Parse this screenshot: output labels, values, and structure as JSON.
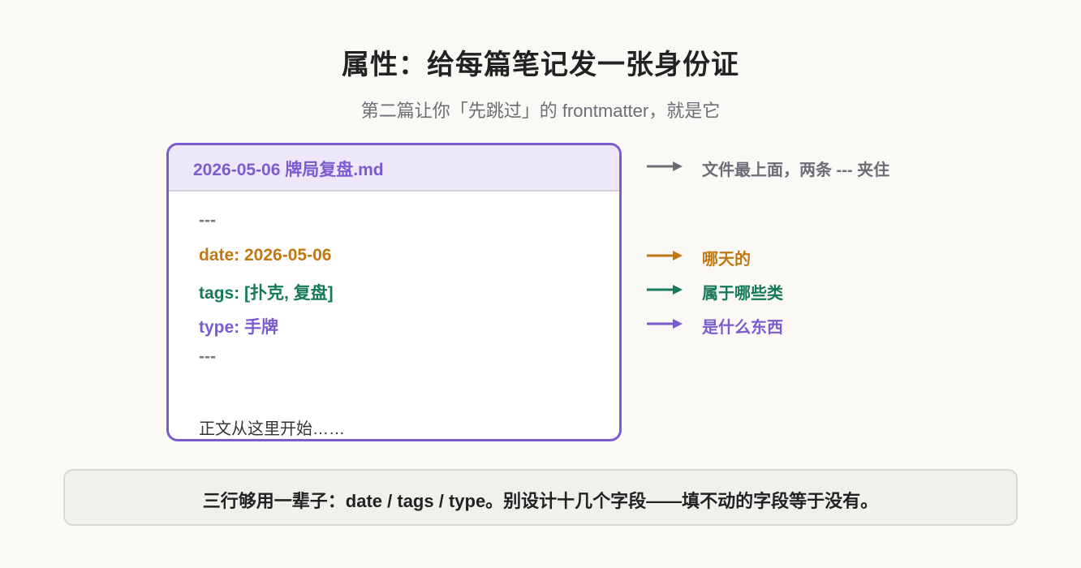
{
  "title": "属性：给每篇笔记发一张身份证",
  "subtitle": "第二篇让你「先跳过」的 frontmatter，就是它",
  "file": {
    "name": "2026-05-06 牌局复盘.md",
    "lines": {
      "open_dash": "---",
      "date": "date: 2026-05-06",
      "tags": "tags: [扑克, 复盘]",
      "type": "type: 手牌",
      "close_dash": "---"
    },
    "body": "正文从这里开始……"
  },
  "annotations": {
    "header": "文件最上面，两条 --- 夹住",
    "date": "哪天的",
    "tags": "属于哪些类",
    "type": "是什么东西"
  },
  "colors": {
    "purple": "#7b5bd0",
    "orange": "#c07813",
    "green": "#15795a",
    "gray": "#6b6e76"
  },
  "summary": "三行够用一辈子：date / tags / type。别设计十几个字段——填不动的字段等于没有。"
}
